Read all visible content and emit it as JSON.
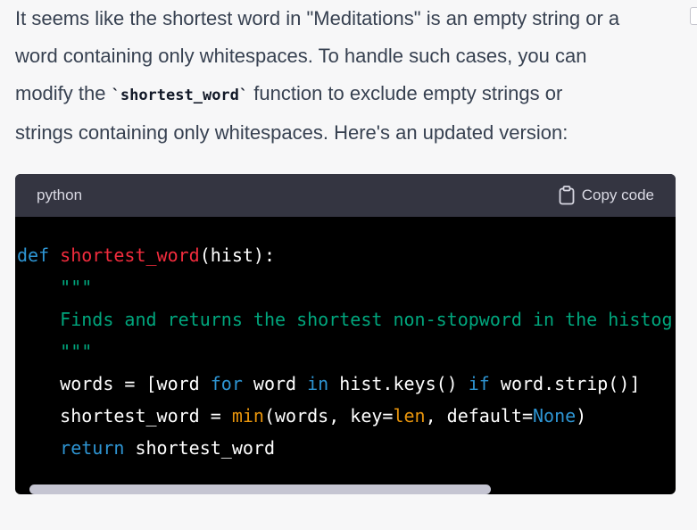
{
  "message": {
    "line1": "It seems like the shortest word in \"Meditations\" is an empty string or a",
    "line2": "word containing only whitespaces. To handle such cases, you can",
    "line3_before": "modify the ",
    "line3_code": "`shortest_word`",
    "line3_after": " function to exclude empty strings or",
    "line4": "strings containing only whitespaces. Here's an updated version:"
  },
  "code_block": {
    "language": "python",
    "copy_label": "Copy code",
    "lines": {
      "l1_def": "def",
      "l1_name": "shortest_word",
      "l1_rest": "(hist):",
      "l2_doc": "\"\"\"",
      "l3_doc": "Finds and returns the shortest non-stopword in the histogram.",
      "l4_doc": "\"\"\"",
      "l5_a": "words = [word ",
      "l5_for": "for",
      "l5_b": " word ",
      "l5_in": "in",
      "l5_c": " hist.keys() ",
      "l5_if": "if",
      "l5_d": " word.strip()]",
      "l6_a": "shortest_word = ",
      "l6_min": "min",
      "l6_b": "(words, key=",
      "l6_len": "len",
      "l6_c": ", default=",
      "l6_none": "None",
      "l6_d": ")",
      "l7_return": "return",
      "l7_rest": " shortest_word"
    }
  },
  "colors": {
    "keyword": "#2e95d3",
    "function_name": "#f22c3d",
    "string": "#00a67d",
    "builtin": "#e9950c"
  },
  "icons": {
    "copy": "clipboard-icon"
  }
}
